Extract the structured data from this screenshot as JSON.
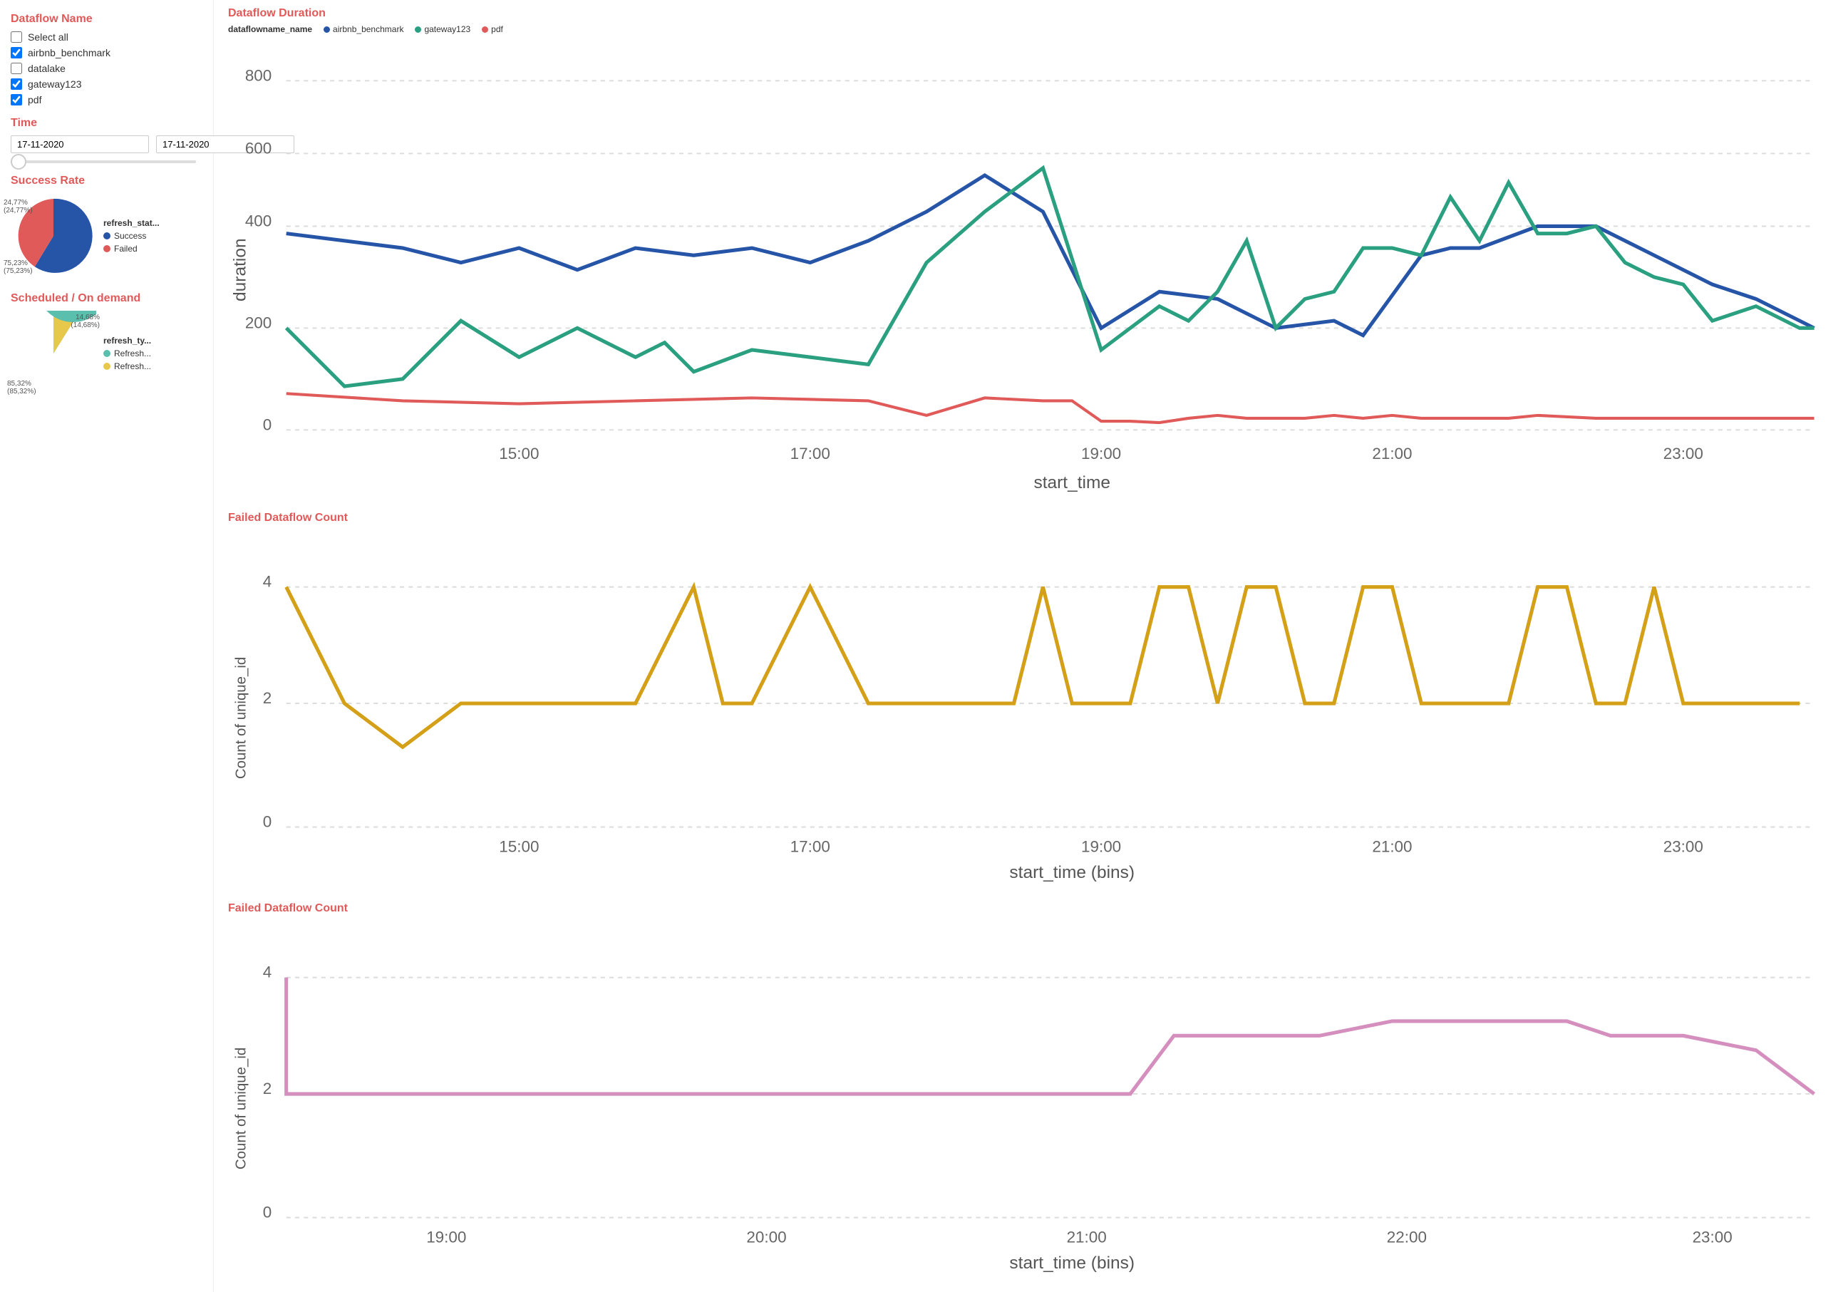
{
  "sidebar": {
    "dataflow_name_title": "Dataflow Name",
    "select_all_label": "Select all",
    "checkboxes": [
      {
        "id": "airbnb_benchmark",
        "label": "airbnb_benchmark",
        "checked": true
      },
      {
        "id": "datalake",
        "label": "datalake",
        "checked": false
      },
      {
        "id": "gateway123",
        "label": "gateway123",
        "checked": true
      },
      {
        "id": "pdf",
        "label": "pdf",
        "checked": true
      }
    ],
    "time_title": "Time",
    "time_start": "17-11-2020",
    "time_end": "17-11-2020",
    "success_rate_title": "Success Rate",
    "pie1": {
      "legend_title": "refresh_stat...",
      "segments": [
        {
          "label": "Success",
          "color": "#3b5998",
          "pct": 75.23,
          "pct_label": "75,23%\n(75,23%)"
        },
        {
          "label": "Failed",
          "color": "#e05a5a",
          "pct": 24.77,
          "pct_label": "24,77%\n(24,77%)"
        }
      ]
    },
    "scheduled_title": "Scheduled / On demand",
    "pie2": {
      "legend_title": "refresh_ty...",
      "segments": [
        {
          "label": "Refresh...",
          "color": "#5bbfad",
          "pct": 85.32,
          "pct_label": "85,32%\n(85,32%)"
        },
        {
          "label": "Refresh...",
          "color": "#e8c84a",
          "pct": 14.68,
          "pct_label": "14,68%\n(14,68%)"
        }
      ]
    }
  },
  "charts": {
    "duration_title": "Dataflow Duration",
    "duration_legend_label": "dataflowname_name",
    "duration_lines": [
      {
        "label": "airbnb_benchmark",
        "color": "#2655a8"
      },
      {
        "label": "gateway123",
        "color": "#2aa080"
      },
      {
        "label": "pdf",
        "color": "#e05a5a"
      }
    ],
    "duration_xaxis": "start_time",
    "duration_yaxis": "duration",
    "duration_yticks": [
      "800",
      "600",
      "400",
      "200",
      "0"
    ],
    "duration_xticks": [
      "15:00",
      "17:00",
      "19:00",
      "21:00",
      "23:00"
    ],
    "failed_count_title": "Failed Dataflow Count",
    "failed_xaxis": "start_time (bins)",
    "failed_yaxis": "Count of unique_id",
    "failed_yticks": [
      "4",
      "2",
      "0"
    ],
    "failed_xticks": [
      "15:00",
      "17:00",
      "19:00",
      "21:00",
      "23:00"
    ],
    "failed_count2_title": "Failed Dataflow Count",
    "failed2_xaxis": "start_time (bins)",
    "failed2_yaxis": "Count of unique_id",
    "failed2_yticks": [
      "4",
      "2",
      "0"
    ],
    "failed2_xticks": [
      "19:00",
      "20:00",
      "21:00",
      "22:00",
      "23:00"
    ]
  },
  "colors": {
    "accent": "#e05a5a",
    "blue": "#2655a8",
    "teal": "#2aa080",
    "pink": "#e05a5a",
    "gold": "#d4a017",
    "orange_yellow": "#e8b84a"
  }
}
